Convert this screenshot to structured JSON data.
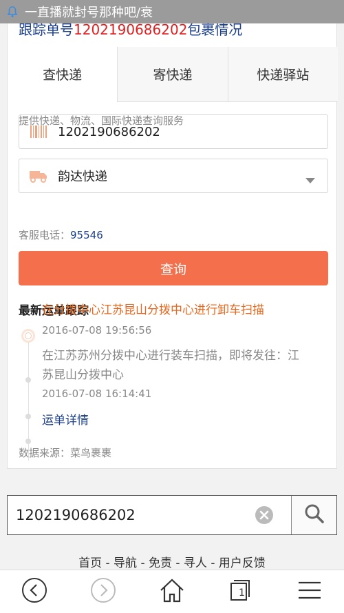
{
  "status_bar": {
    "notification_title": "一直播就封号那种吧/衰"
  },
  "heading": {
    "prefix": "跟踪单号",
    "number": "1202190686202",
    "suffix": "包裹情况"
  },
  "tabs": [
    {
      "label": "查快递"
    },
    {
      "label": "寄快递"
    },
    {
      "label": "快递驿站"
    }
  ],
  "form": {
    "description": "提供快递、物流、国际快递查询服务",
    "tracking_number": "1202190686202",
    "courier": "韵达快递",
    "phone_label": "客服电话：",
    "phone_number": "95546",
    "query_label": "查询"
  },
  "tracking": {
    "title": "最新运单跟踪",
    "events": [
      {
        "text": "在分拨中心江苏昆山分拨中心进行卸车扫描",
        "time": "2016-07-08 19:56:56"
      },
      {
        "text": "在江苏苏州分拨中心进行装车扫描，即将发往：江苏昆山分拨中心",
        "time": "2016-07-08 16:14:41"
      }
    ],
    "detail_link": "运单详情",
    "source": "数据来源：菜鸟裹裹"
  },
  "search": {
    "value": "1202190686202"
  },
  "footer": {
    "links": "首页 - 导航 - 免责 - 寻人 - 用户反馈"
  },
  "browser_nav": {
    "tab_count": "1"
  },
  "colors": {
    "accent": "#f4704c",
    "link": "#1b3f8c",
    "highlight": "#e8681e"
  }
}
